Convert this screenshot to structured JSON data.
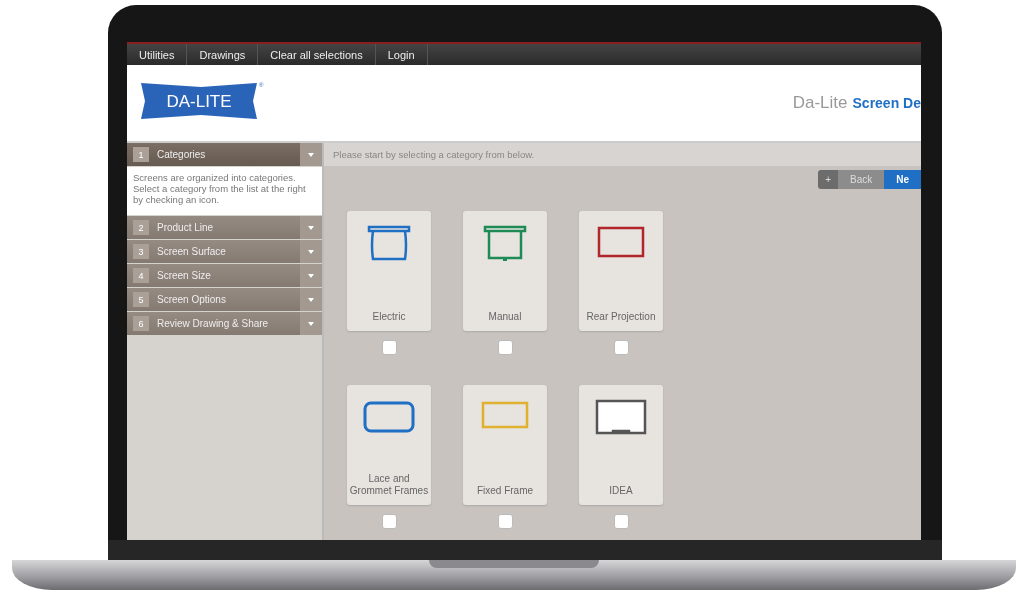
{
  "nav_menu": [
    {
      "label": "Utilities"
    },
    {
      "label": "Drawings"
    },
    {
      "label": "Clear all selections"
    },
    {
      "label": "Login"
    }
  ],
  "header": {
    "logo": {
      "text": "DA-LITE",
      "mark": "®"
    },
    "brand": "Da-Lite",
    "app_title": "Screen De"
  },
  "steps": [
    {
      "number": "1",
      "label": "Categories",
      "expanded": true,
      "description": "Screens are organized into categories. Select a category from the list at the right by checking an icon."
    },
    {
      "number": "2",
      "label": "Product Line",
      "expanded": false
    },
    {
      "number": "3",
      "label": "Screen Surface",
      "expanded": false
    },
    {
      "number": "4",
      "label": "Screen Size",
      "expanded": false
    },
    {
      "number": "5",
      "label": "Screen Options",
      "expanded": false
    },
    {
      "number": "6",
      "label": "Review Drawing & Share",
      "expanded": false
    }
  ],
  "instruction": "Please start by selecting a category from below.",
  "pager": {
    "plus": "+",
    "back": "Back",
    "next": "Ne"
  },
  "categories": [
    {
      "label": "Electric",
      "kind": "electric",
      "color": "#1f6fc4",
      "checked": false
    },
    {
      "label": "Manual",
      "kind": "manual",
      "color": "#1e8a55",
      "checked": false
    },
    {
      "label": "Rear Projection",
      "kind": "rear",
      "color": "#b0262b",
      "checked": false
    },
    {
      "label": "Lace and Grommet Frames",
      "kind": "lace",
      "color": "#1f6fc4",
      "checked": false
    },
    {
      "label": "Fixed Frame",
      "kind": "fixed",
      "color": "#e0b030",
      "checked": false
    },
    {
      "label": "IDEA",
      "kind": "idea",
      "color": "#555555",
      "checked": false
    }
  ]
}
